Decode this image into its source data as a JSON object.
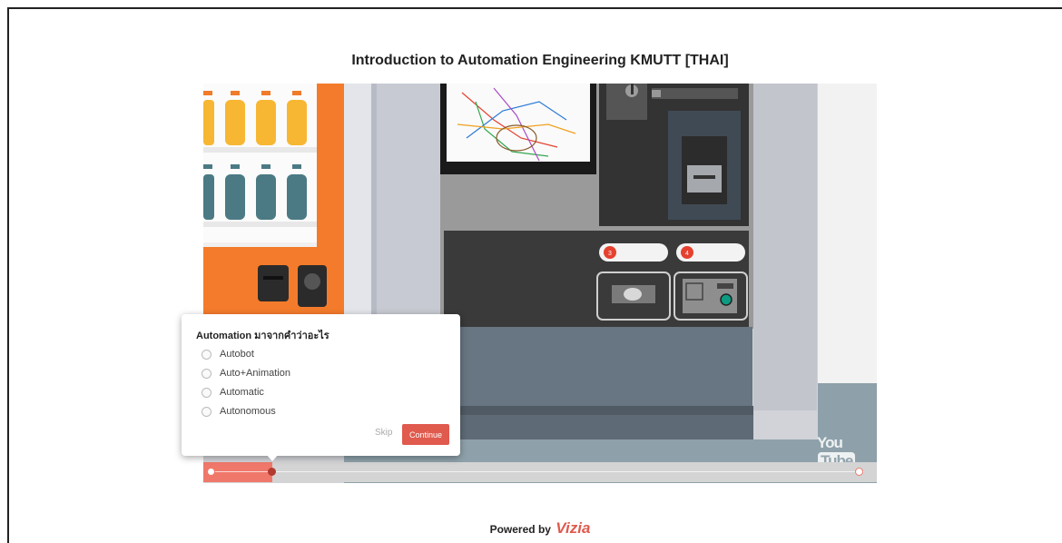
{
  "page": {
    "title": "Introduction to Automation Engineering KMUTT [THAI]"
  },
  "video": {
    "markers": [
      "3",
      "4"
    ],
    "youtube": {
      "you": "You",
      "tube": "Tube"
    }
  },
  "quiz": {
    "question": "Automation มาจากคำว่าอะไร",
    "options": [
      "Autobot",
      "Auto+Animation",
      "Automatic",
      "Autonomous"
    ],
    "skip_label": "Skip",
    "continue_label": "Continue"
  },
  "footer": {
    "powered_by": "Powered by",
    "brand": "Vizia"
  },
  "colors": {
    "accent": "#e05a4e",
    "machine_orange": "#f47b2b",
    "timeline_played": "#f0786a"
  }
}
